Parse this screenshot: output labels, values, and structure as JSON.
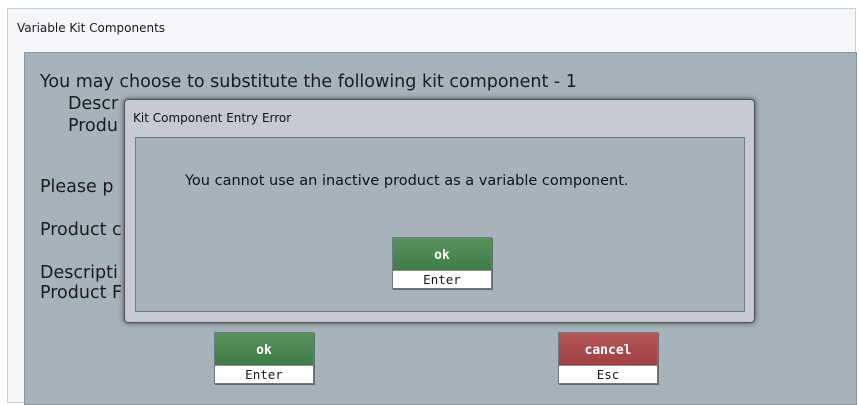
{
  "window": {
    "title": "Variable Kit Components"
  },
  "panel": {
    "line1": "You may choose to substitute the following kit component - 1",
    "description_label": "Descr",
    "product_label": "Produ",
    "please_label": "Please p",
    "product_code_label": "Product c",
    "description2_label": "Descripti",
    "product_f_label": "Product F"
  },
  "buttons": {
    "ok_label": "ok",
    "ok_key": "Enter",
    "cancel_label": "cancel",
    "cancel_key": "Esc"
  },
  "dialog": {
    "title": "Kit Component Entry Error",
    "message": "You cannot use an inactive product as a variable component.",
    "ok_label": "ok",
    "ok_key": "Enter"
  },
  "colors": {
    "panel_bg": "#a7b3bb",
    "ok_green": "#4d8a52",
    "cancel_red": "#ab4b4e"
  }
}
